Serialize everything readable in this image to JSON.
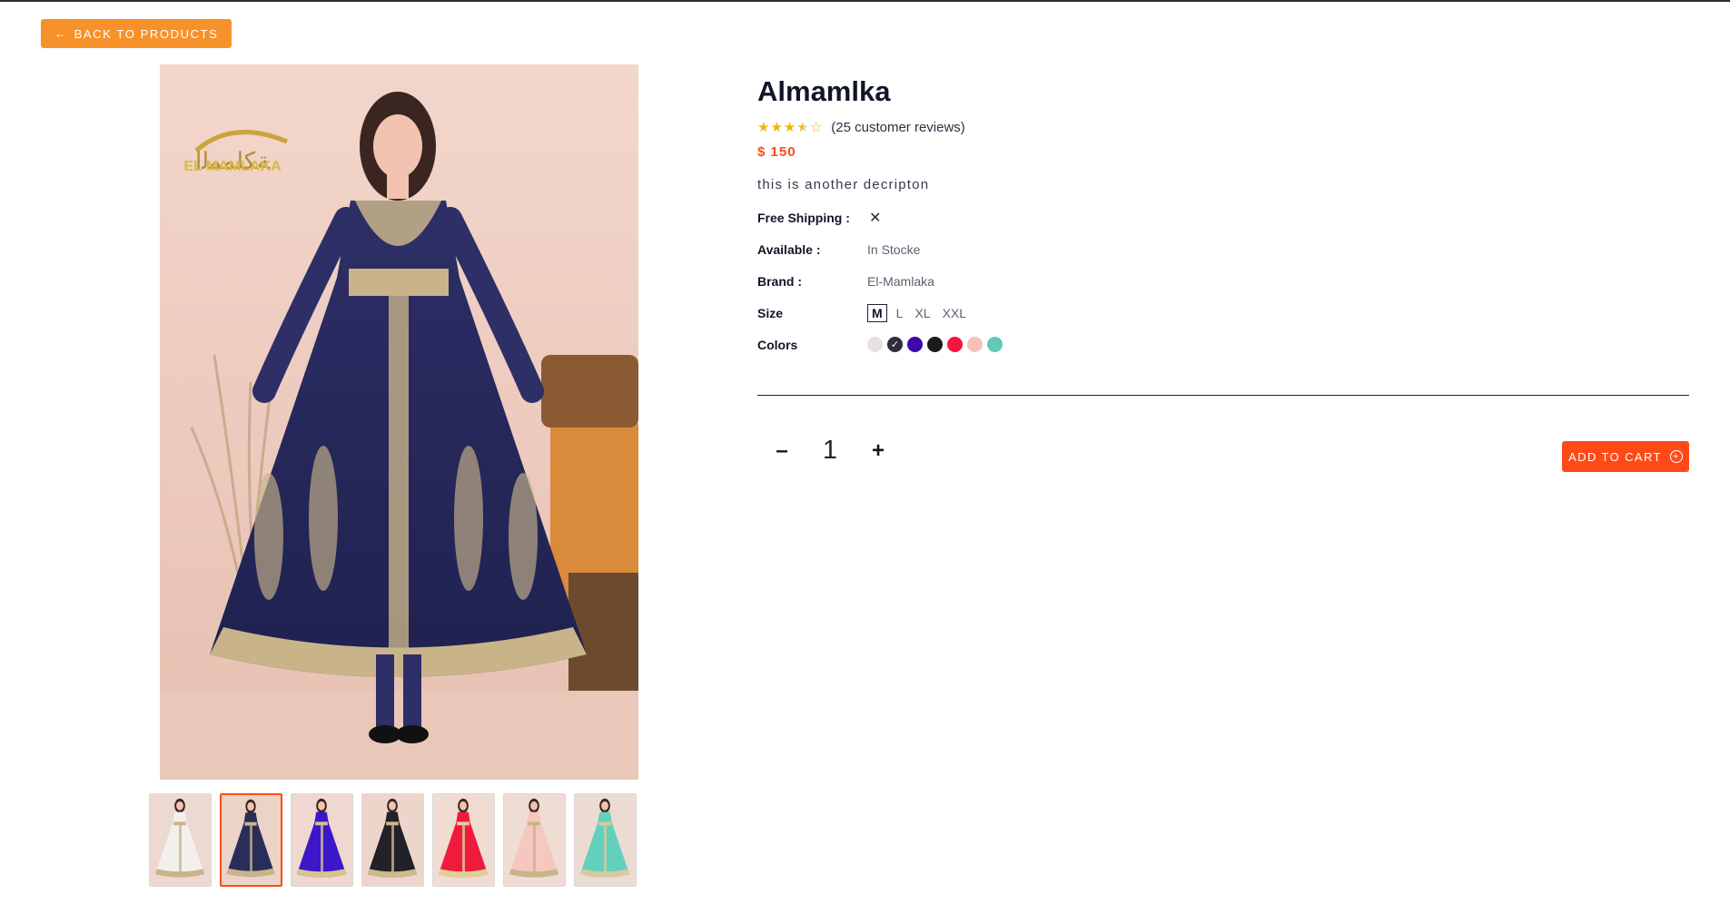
{
  "nav": {
    "back_label": "BACK TO PRODUCTS",
    "back_icon": "arrow-left-icon"
  },
  "product": {
    "title": "Almamlka",
    "rating": 3.5,
    "rating_max": 5,
    "reviews_text": "(25 customer reviews)",
    "price": "$ 150",
    "description": "this is another decripton",
    "image_watermark": "EL MAMLAKA"
  },
  "attributes": {
    "shipping_label": "Free Shipping :",
    "shipping_icon": "close-icon",
    "available_label": "Available :",
    "available_value": "In Stocke",
    "brand_label": "Brand :",
    "brand_value": "El-Mamlaka",
    "size_label": "Size",
    "sizes": [
      "M",
      "L",
      "XL",
      "XXL"
    ],
    "selected_size": "M",
    "colors_label": "Colors",
    "colors": [
      "#e8e1e3",
      "#2f2c3e",
      "#3d0aa8",
      "#1b1b1b",
      "#f4163c",
      "#f7c1b9",
      "#5fcbb6"
    ],
    "selected_color": "#2f2c3e"
  },
  "thumbnails": [
    {
      "dress": "#f3f0ec",
      "trim": "#c9b48a",
      "bg": "#ecd9d2"
    },
    {
      "dress": "#2a2c5a",
      "trim": "#c9b48a",
      "bg": "#ecd3c7"
    },
    {
      "dress": "#3c17c9",
      "trim": "#d6c38f",
      "bg": "#eed8cf"
    },
    {
      "dress": "#222029",
      "trim": "#cdb98d",
      "bg": "#ecd6cc"
    },
    {
      "dress": "#f01a3a",
      "trim": "#e0cf9c",
      "bg": "#f0dcd3"
    },
    {
      "dress": "#f6c7bf",
      "trim": "#c9b48a",
      "bg": "#efdcd3"
    },
    {
      "dress": "#62d0bd",
      "trim": "#d7c9a0",
      "bg": "#ecdbd2"
    }
  ],
  "active_thumbnail": 1,
  "quantity": {
    "value": "1",
    "minus": "–",
    "plus": "+"
  },
  "cart": {
    "label": "ADD TO CART",
    "icon": "plus-circle-icon"
  }
}
